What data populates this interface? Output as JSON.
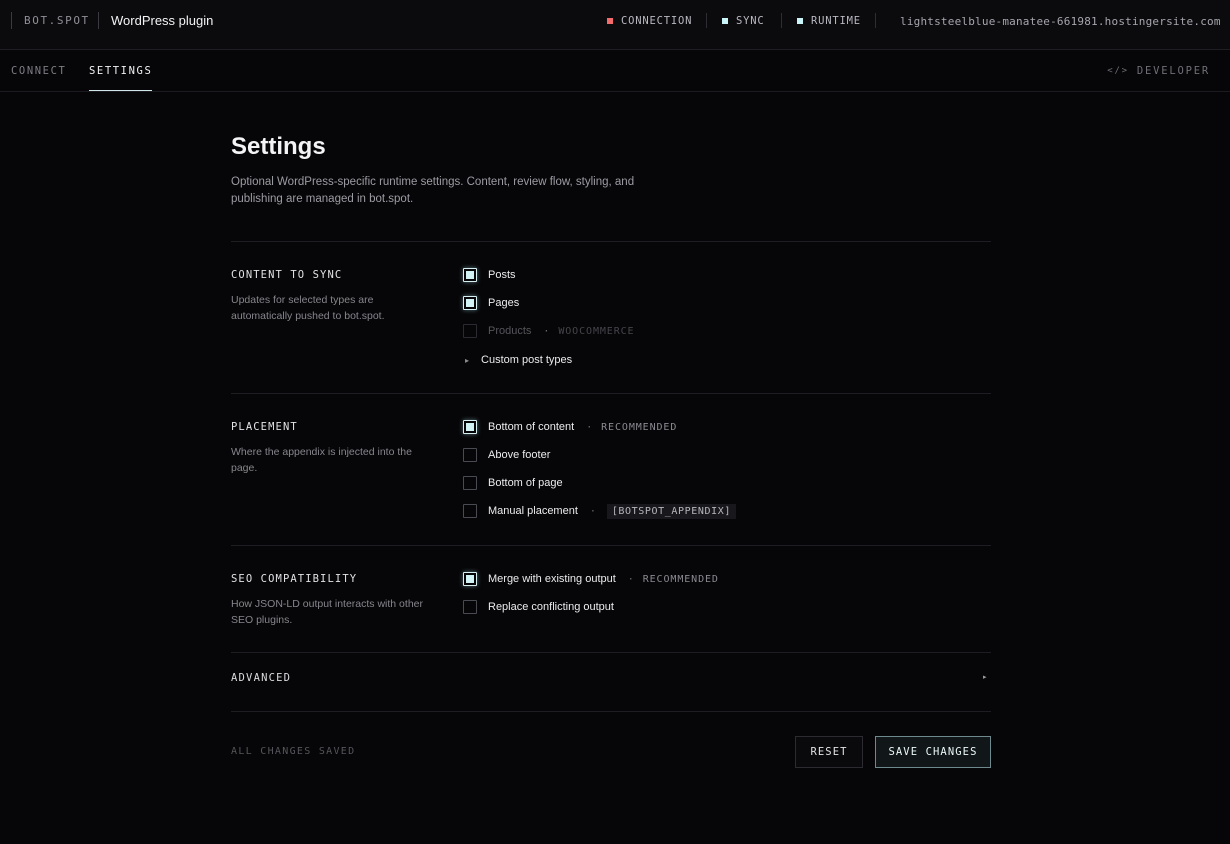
{
  "header": {
    "brand": "BOT.SPOT",
    "product": "WordPress plugin",
    "statuses": [
      {
        "label": "CONNECTION",
        "color": "#f36b6b"
      },
      {
        "label": "SYNC",
        "color": "#c9f4f8"
      },
      {
        "label": "RUNTIME",
        "color": "#c9f4f8"
      }
    ],
    "host": "lightsteelblue-manatee-661981.hostingersite.com"
  },
  "nav": {
    "tabs": [
      {
        "label": "CONNECT",
        "active": false
      },
      {
        "label": "SETTINGS",
        "active": true
      }
    ],
    "developer_label": "DEVELOPER"
  },
  "page": {
    "title": "Settings",
    "subtitle": "Optional WordPress-specific runtime settings. Content, review flow, styling, and publishing are managed in bot.spot."
  },
  "sections": {
    "content": {
      "title": "CONTENT TO SYNC",
      "description": "Updates for selected types are automatically pushed to bot.spot.",
      "options": [
        {
          "label": "Posts",
          "checked": true
        },
        {
          "label": "Pages",
          "checked": true
        },
        {
          "label": "Products",
          "checked": false,
          "disabled": true,
          "tag": "WOOCOMMERCE"
        }
      ],
      "custom_post_types": "Custom post types"
    },
    "placement": {
      "title": "PLACEMENT",
      "description": "Where the appendix is injected into the page.",
      "options": [
        {
          "label": "Bottom of content",
          "checked": true,
          "tag": "RECOMMENDED"
        },
        {
          "label": "Above footer",
          "checked": false
        },
        {
          "label": "Bottom of page",
          "checked": false
        },
        {
          "label": "Manual placement",
          "checked": false,
          "code": "[BOTSPOT_APPENDIX]"
        }
      ]
    },
    "seo": {
      "title": "SEO COMPATIBILITY",
      "description": "How JSON-LD output interacts with other SEO plugins.",
      "options": [
        {
          "label": "Merge with existing output",
          "checked": true,
          "tag": "RECOMMENDED"
        },
        {
          "label": "Replace conflicting output",
          "checked": false
        }
      ]
    },
    "advanced": {
      "title": "ADVANCED"
    }
  },
  "footer": {
    "status": "ALL CHANGES SAVED",
    "reset_label": "RESET",
    "save_label": "SAVE CHANGES"
  },
  "separator": "·"
}
